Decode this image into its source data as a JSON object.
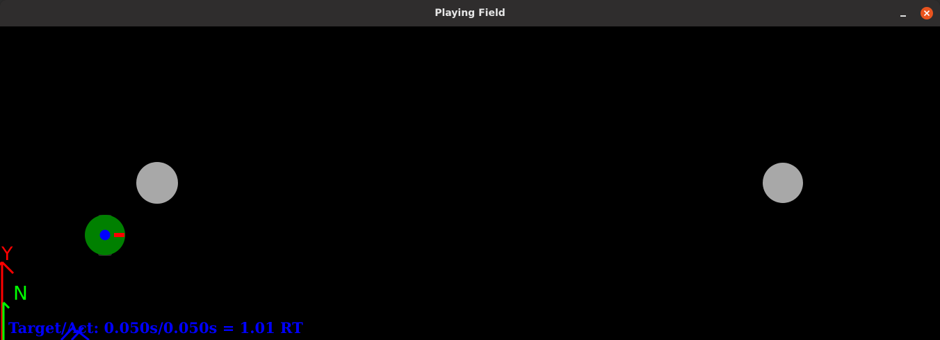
{
  "window": {
    "title": "Playing Field"
  },
  "field": {
    "axis_labels": {
      "y": "Y",
      "n": "N"
    },
    "status_text": "Target/Act: 0.050s/0.050s = 1.01 RT",
    "colors": {
      "background": "#000000",
      "obstacle": "#a8a8a8",
      "robot_body": "#008000",
      "robot_center": "#0000ff",
      "robot_heading": "#ff0000",
      "axis_y": "#ff0000",
      "axis_n": "#00ff00",
      "axis_x": "#0000ff"
    }
  }
}
